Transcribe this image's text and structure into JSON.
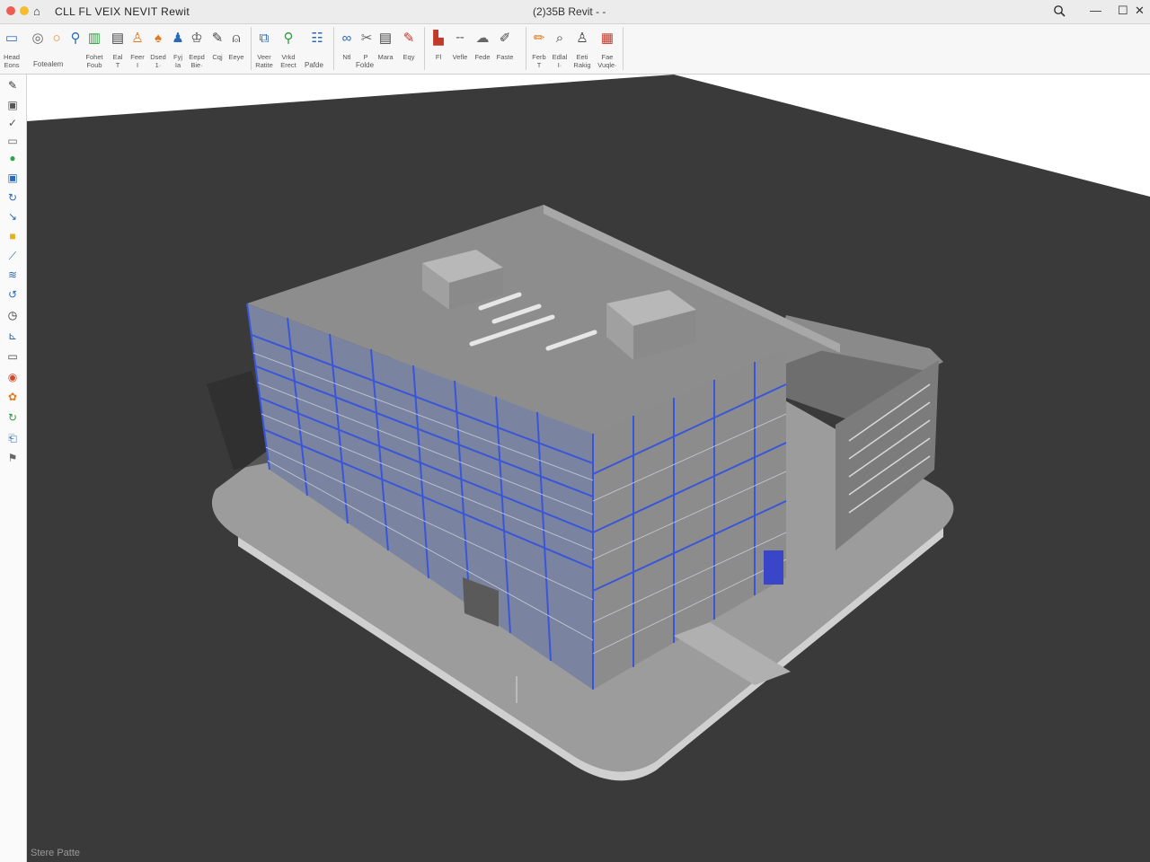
{
  "titlebar": {
    "app_title": "CLL  FL  VEIX  NEVIT Rewit",
    "file_title": "(2)35B Revit - -",
    "search_icon": "search-icon",
    "minimize_label": "—",
    "maximize_label": "☐",
    "close_label": "✕"
  },
  "ribbon": {
    "groups": [
      {
        "label": "Fotealem"
      },
      {
        "label": "Folde"
      },
      {
        "label": "Pafde"
      }
    ],
    "tools": [
      {
        "l1": "Head",
        "l2": "Eons"
      },
      {
        "l1": "",
        "l2": ""
      },
      {
        "l1": "",
        "l2": ""
      },
      {
        "l1": "",
        "l2": ""
      },
      {
        "l1": "Fohet",
        "l2": "Foub"
      },
      {
        "l1": "Eal",
        "l2": "T"
      },
      {
        "l1": "Feer",
        "l2": "I"
      },
      {
        "l1": "Dsed",
        "l2": "1·"
      },
      {
        "l1": "Fyj",
        "l2": "Ia"
      },
      {
        "l1": "Eepd",
        "l2": "Bie·"
      },
      {
        "l1": "Cqj",
        "l2": ""
      },
      {
        "l1": "Eeye",
        "l2": ""
      },
      {
        "l1": "Veer",
        "l2": "Ratite"
      },
      {
        "l1": "Vrkd",
        "l2": "Erect"
      },
      {
        "l1": "",
        "l2": ""
      },
      {
        "l1": "Ntl",
        "l2": ""
      },
      {
        "l1": "P",
        "l2": ""
      },
      {
        "l1": "Mara",
        "l2": ""
      },
      {
        "l1": "Eqy",
        "l2": ""
      },
      {
        "l1": "Fl",
        "l2": ""
      },
      {
        "l1": "Vefle",
        "l2": ""
      },
      {
        "l1": "Fede",
        "l2": ""
      },
      {
        "l1": "Faste",
        "l2": ""
      },
      {
        "l1": "Ferb",
        "l2": "T"
      },
      {
        "l1": "Edlal",
        "l2": "I·"
      },
      {
        "l1": "Eeti",
        "l2": "Rakig"
      },
      {
        "l1": "Fae",
        "l2": "Vuqle·"
      }
    ]
  },
  "sidebar": {
    "icons": [
      "wrench-icon",
      "edit-icon",
      "check-icon",
      "panel-icon",
      "globe-icon",
      "image-icon",
      "rotate-icon",
      "cursor-icon",
      "folder-icon",
      "link-icon",
      "layers-icon",
      "refresh-icon",
      "clock-icon",
      "tree-icon",
      "window-icon",
      "chrome-icon",
      "paint-icon",
      "cycle-icon",
      "page-icon",
      "flag-icon"
    ]
  },
  "view": {
    "label": "Stere Patte"
  },
  "colors": {
    "accent": "#3a56d8",
    "ground": "#3a3a3a",
    "plate": "#9c9c9c"
  }
}
